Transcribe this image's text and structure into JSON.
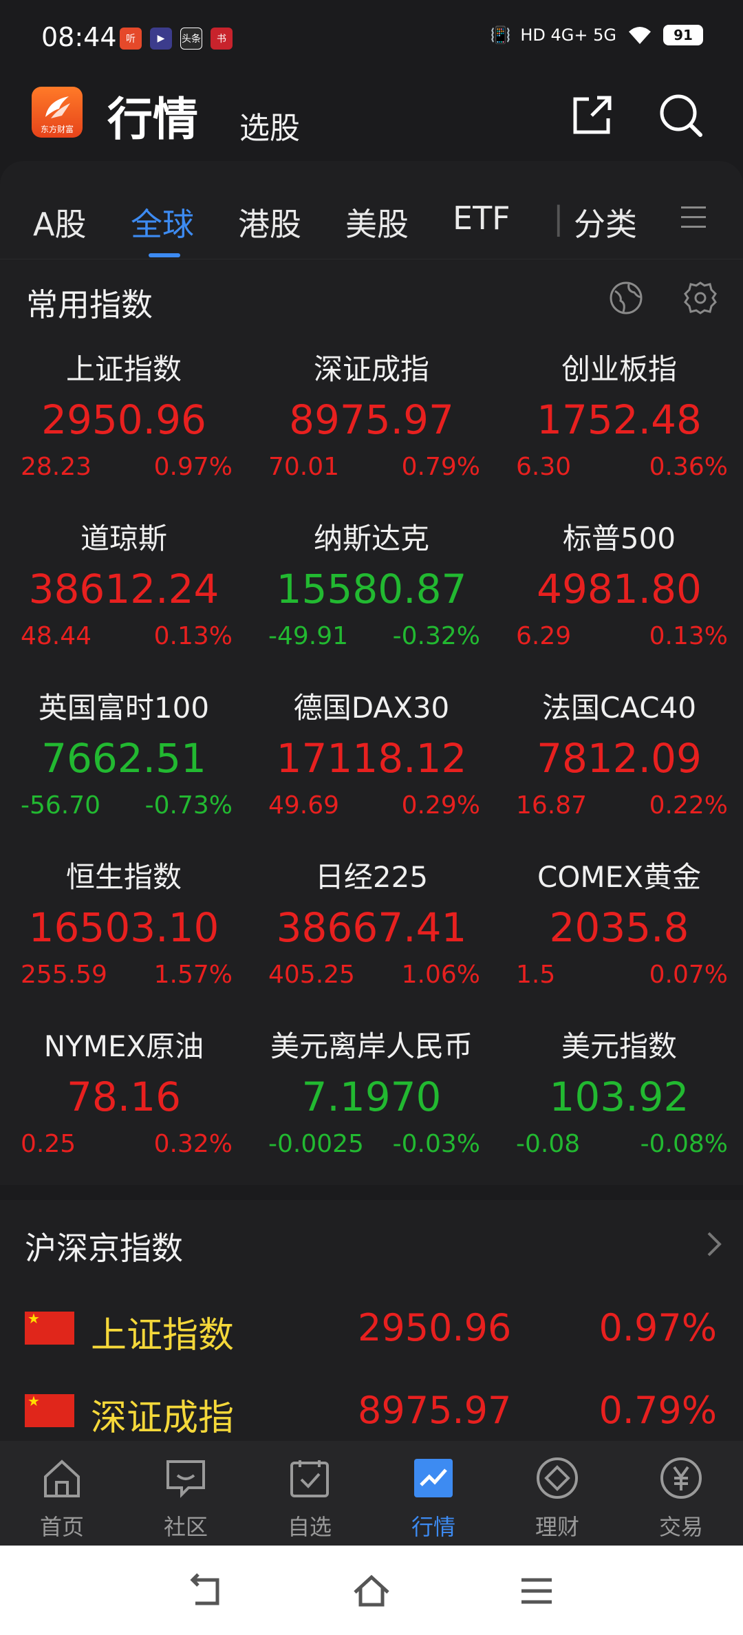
{
  "status_bar": {
    "time": "08:44",
    "apps": [
      "听",
      "▶",
      "头条",
      "书"
    ],
    "network": "HD 4G+ 5G",
    "battery": "91"
  },
  "header": {
    "logo_text": "东方财富",
    "title": "行情",
    "subtitle": "选股"
  },
  "tabs": [
    {
      "label": "A股"
    },
    {
      "label": "全球"
    },
    {
      "label": "港股"
    },
    {
      "label": "美股"
    },
    {
      "label": "ETF"
    },
    {
      "label": "分类"
    }
  ],
  "common_indices": {
    "title": "常用指数",
    "items": [
      {
        "name": "上证指数",
        "price": "2950.96",
        "change": "28.23",
        "pct": "0.97%",
        "dir": "up"
      },
      {
        "name": "深证成指",
        "price": "8975.97",
        "change": "70.01",
        "pct": "0.79%",
        "dir": "up"
      },
      {
        "name": "创业板指",
        "price": "1752.48",
        "change": "6.30",
        "pct": "0.36%",
        "dir": "up"
      },
      {
        "name": "道琼斯",
        "price": "38612.24",
        "change": "48.44",
        "pct": "0.13%",
        "dir": "up"
      },
      {
        "name": "纳斯达克",
        "price": "15580.87",
        "change": "-49.91",
        "pct": "-0.32%",
        "dir": "dn"
      },
      {
        "name": "标普500",
        "price": "4981.80",
        "change": "6.29",
        "pct": "0.13%",
        "dir": "up"
      },
      {
        "name": "英国富时100",
        "price": "7662.51",
        "change": "-56.70",
        "pct": "-0.73%",
        "dir": "dn"
      },
      {
        "name": "德国DAX30",
        "price": "17118.12",
        "change": "49.69",
        "pct": "0.29%",
        "dir": "up"
      },
      {
        "name": "法国CAC40",
        "price": "7812.09",
        "change": "16.87",
        "pct": "0.22%",
        "dir": "up"
      },
      {
        "name": "恒生指数",
        "price": "16503.10",
        "change": "255.59",
        "pct": "1.57%",
        "dir": "up"
      },
      {
        "name": "日经225",
        "price": "38667.41",
        "change": "405.25",
        "pct": "1.06%",
        "dir": "up"
      },
      {
        "name": "COMEX黄金",
        "price": "2035.8",
        "change": "1.5",
        "pct": "0.07%",
        "dir": "up"
      },
      {
        "name": "NYMEX原油",
        "price": "78.16",
        "change": "0.25",
        "pct": "0.32%",
        "dir": "up"
      },
      {
        "name": "美元离岸人民币",
        "price": "7.1970",
        "change": "-0.0025",
        "pct": "-0.03%",
        "dir": "dn"
      },
      {
        "name": "美元指数",
        "price": "103.92",
        "change": "-0.08",
        "pct": "-0.08%",
        "dir": "dn"
      }
    ]
  },
  "hs_indices": {
    "title": "沪深京指数",
    "rows": [
      {
        "name": "上证指数",
        "price": "2950.96",
        "pct": "0.97%"
      },
      {
        "name": "深证成指",
        "price": "8975.97",
        "pct": "0.79%"
      }
    ]
  },
  "bottom_nav": [
    {
      "label": "首页",
      "icon": "home-icon"
    },
    {
      "label": "社区",
      "icon": "community-icon"
    },
    {
      "label": "自选",
      "icon": "watchlist-icon"
    },
    {
      "label": "行情",
      "icon": "market-icon"
    },
    {
      "label": "理财",
      "icon": "wealth-icon"
    },
    {
      "label": "交易",
      "icon": "trade-icon"
    }
  ],
  "colors": {
    "up": "#e8201f",
    "down": "#22b931",
    "accent": "#3d8bf2",
    "highlight_name": "#f5d83a"
  }
}
